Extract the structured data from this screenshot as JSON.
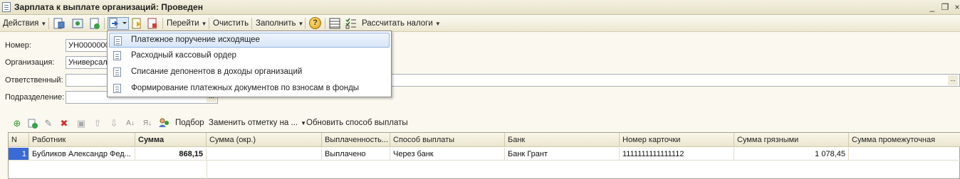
{
  "window": {
    "title": "Зарплата к выплате организаций: Проведен",
    "minimize_glyph": "_",
    "maximize_glyph": "❐",
    "close_glyph": "×"
  },
  "toolbar": {
    "actions_label": "Действия",
    "goto_label": "Перейти",
    "clear_label": "Очистить",
    "fill_label": "Заполнить",
    "help_glyph": "?",
    "calc_taxes_label": "Рассчитать налоги"
  },
  "form": {
    "number_label": "Номер:",
    "number_value": "УН00000000",
    "org_label": "Организация:",
    "org_value": "Универсал",
    "responsible_label": "Ответственный:",
    "responsible_value": "",
    "division_label": "Подразделение:",
    "division_value": "",
    "dots": "..."
  },
  "menu": {
    "items": [
      "Платежное поручение исходящее",
      "Расходный кассовый ордер",
      "Списание депонентов в доходы организаций",
      "Формирование платежных документов по взносам в фонды"
    ]
  },
  "table_toolbar": {
    "select_label": "Подбор",
    "replace_mark_label": "Заменить отметку на ...",
    "update_method_label": "Обновить способ выплаты"
  },
  "table": {
    "headers": [
      "N",
      "Работник",
      "Сумма",
      "Сумма (окр.)",
      "Выплаченность...",
      "Способ выплаты",
      "Банк",
      "Номер карточки",
      "Сумма грязными",
      "Сумма промежуточная"
    ],
    "rows": [
      [
        "1",
        "Бубликов Александр Фед...",
        "868,15",
        "",
        "Выплачено",
        "Через банк",
        "Банк Грант",
        "1111111111111112",
        "1 078,45",
        ""
      ]
    ]
  },
  "colors": {
    "accent": "#3a6ad6",
    "background": "#fbf9ef",
    "highlight": "#d9e7f8"
  }
}
